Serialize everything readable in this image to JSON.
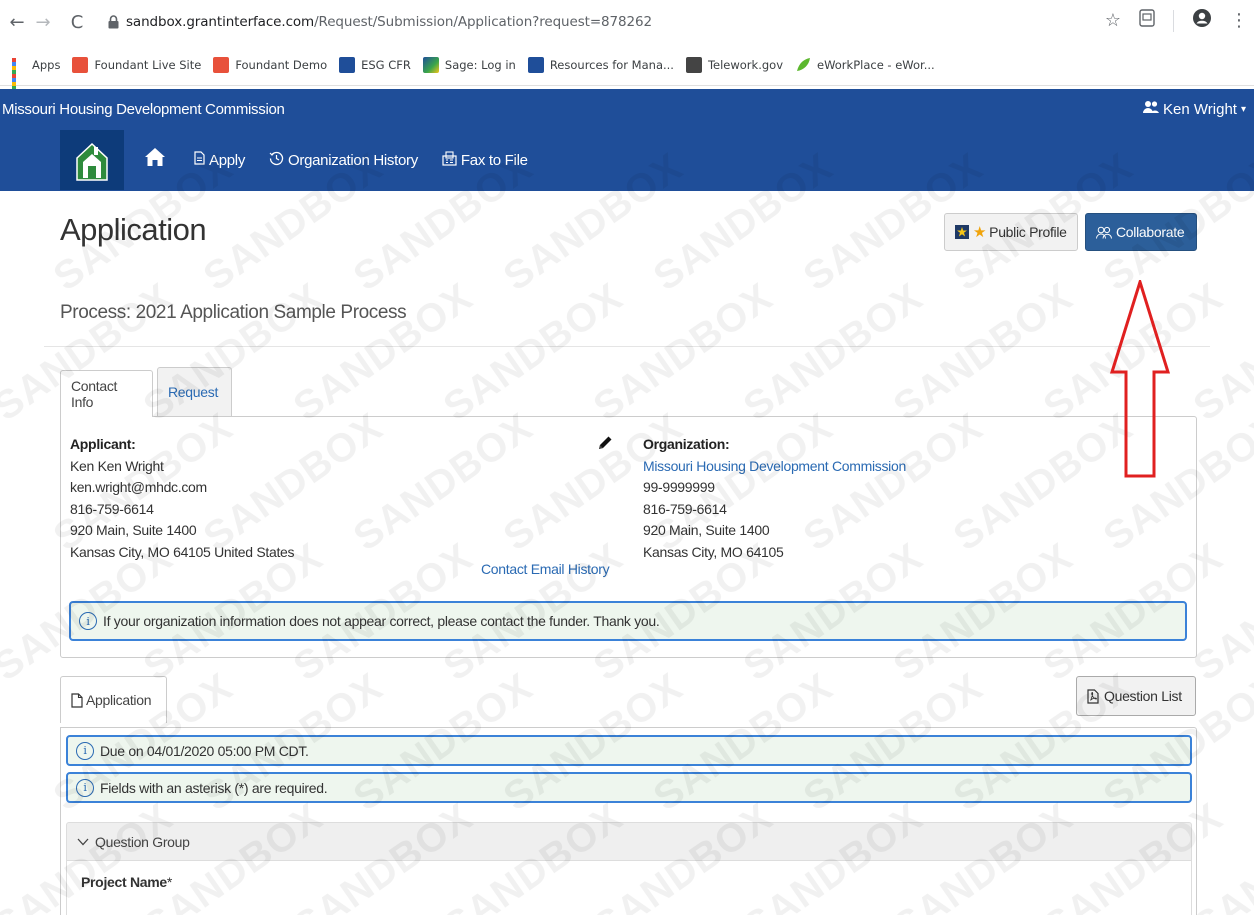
{
  "browser": {
    "url_host": "sandbox.grantinterface.com",
    "url_path": "/Request/Submission/Application?request=878262",
    "bookmarks": [
      {
        "label": "Apps",
        "icon": "apps-grid-icon",
        "color": "#1a73e8"
      },
      {
        "label": "Foundant Live Site",
        "icon": "foundant-icon",
        "color": "#e8513b"
      },
      {
        "label": "Foundant Demo",
        "icon": "foundant-icon",
        "color": "#e8513b"
      },
      {
        "label": "ESG CFR",
        "icon": "gpo-icon",
        "color": "#1f4e99"
      },
      {
        "label": "Sage: Log in",
        "icon": "sage-icon",
        "color": "#3aa64a"
      },
      {
        "label": "Resources for Mana...",
        "icon": "gsa-icon",
        "color": "#1f4e99"
      },
      {
        "label": "Telework.gov",
        "icon": "telework-icon",
        "color": "#333333"
      },
      {
        "label": "eWorkPlace - eWor...",
        "icon": "leaf-icon",
        "color": "#5cb82e"
      }
    ]
  },
  "site": {
    "org_name": "Missouri Housing Development Commission",
    "user_name": "Ken Wright",
    "brand_color": "#1f4e99",
    "nav": {
      "apply": "Apply",
      "org_history": "Organization History",
      "fax": "Fax to File"
    }
  },
  "page": {
    "title": "Application",
    "public_profile_label": "Public Profile",
    "collaborate_label": "Collaborate",
    "process": "Process: 2021 Application Sample Process",
    "watermark": "SANDBOX"
  },
  "contact": {
    "tabs": {
      "contact_info": "Contact Info",
      "request": "Request"
    },
    "applicant": {
      "heading": "Applicant:",
      "name": "Ken Ken Wright",
      "email": "ken.wright@mhdc.com",
      "phone": "816-759-6614",
      "address1": "920 Main, Suite 1400",
      "address2": "Kansas City, MO 64105 United States"
    },
    "email_history_label": "Contact Email History",
    "organization": {
      "heading": "Organization:",
      "name": "Missouri Housing Development Commission",
      "ein": "99-9999999",
      "phone": "816-759-6614",
      "address1": "920 Main, Suite 1400",
      "address2": "Kansas City, MO 64105"
    },
    "org_notice": "If your organization information does not appear correct, please contact the funder. Thank you."
  },
  "application": {
    "tab_label": "Application",
    "question_list_label": "Question List",
    "due_notice": "Due on 04/01/2020 05:00 PM CDT.",
    "required_notice": "Fields with an asterisk (*) are required.",
    "question_group_label": "Question Group",
    "project_name_label": "Project Name",
    "required_marker": "*"
  }
}
